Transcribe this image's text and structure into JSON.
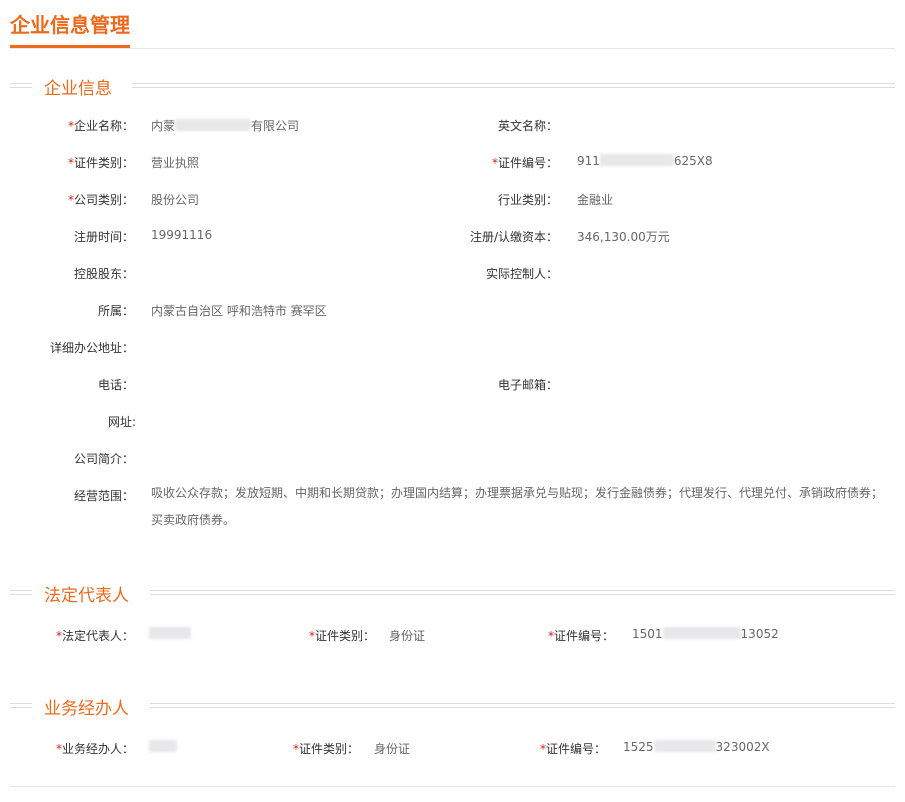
{
  "page": {
    "title": "企业信息管理"
  },
  "sections": {
    "company": "企业信息",
    "legal": "法定代表人",
    "agent": "业务经办人"
  },
  "company": {
    "name_label": "企业名称：",
    "name_value_start": "内蒙",
    "name_value_end": "有限公司",
    "en_name_label": "英文名称：",
    "cert_type_label": "证件类别：",
    "cert_type_value": "营业执照",
    "cert_no_label": "证件编号：",
    "cert_no_start": "911",
    "cert_no_end": "625X8",
    "company_type_label": "公司类别：",
    "company_type_value": "股份公司",
    "industry_label": "行业类别：",
    "industry_value": "金融业",
    "reg_time_label": "注册时间：",
    "reg_time_value": "19991116",
    "capital_label": "注册/认缴资本：",
    "capital_value": "346,130.00万元",
    "shareholder_label": "控股股东：",
    "controller_label": "实际控制人：",
    "region_label": "所属：",
    "region_value": "内蒙古自治区 呼和浩特市 赛罕区",
    "address_label": "详细办公地址：",
    "phone_label": "电话：",
    "email_label": "电子邮箱：",
    "website_label": "网址:",
    "intro_label": "公司简介：",
    "scope_label": "经营范围：",
    "scope_value": "吸收公众存款；发放短期、中期和长期贷款；办理国内结算；办理票据承兑与贴现；发行金融债券；代理发行、代理兑付、承销政府债券；买卖政府债券。"
  },
  "legal": {
    "name_label": "法定代表人：",
    "cert_type_label": "证件类别：",
    "cert_type_value": "身份证",
    "cert_no_label": "证件编号：",
    "cert_no_start": "1501",
    "cert_no_end": "13052"
  },
  "agent": {
    "name_label": "业务经办人：",
    "cert_type_label": "证件类别：",
    "cert_type_value": "身份证",
    "cert_no_label": "证件编号：",
    "cert_no_start": "1525",
    "cert_no_end": "323002X"
  },
  "required_mark": "*"
}
